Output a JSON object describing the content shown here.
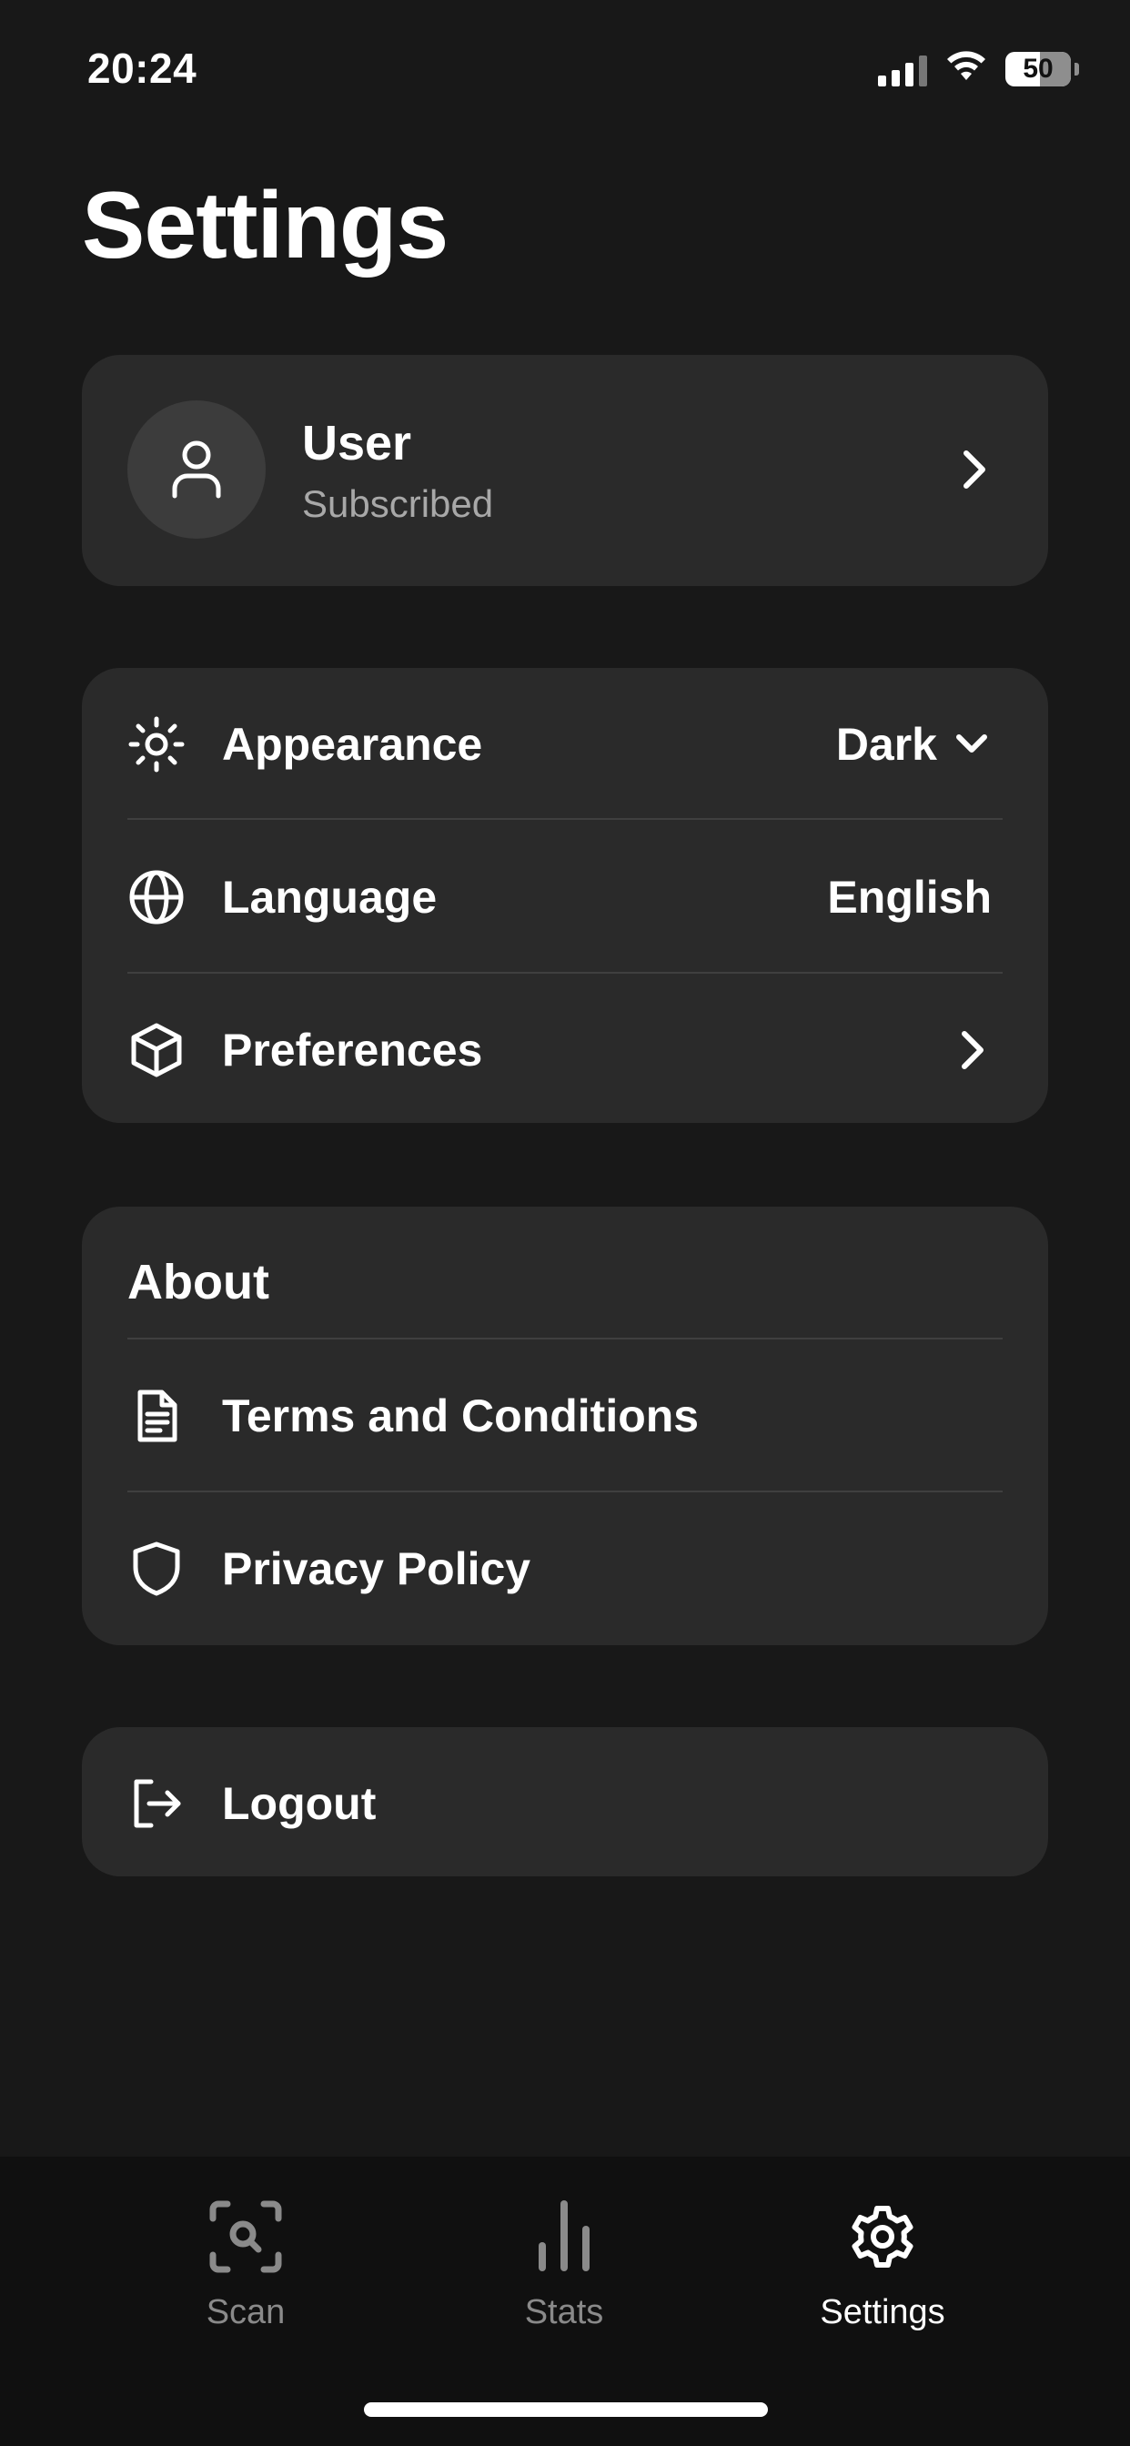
{
  "status_bar": {
    "time": "20:24",
    "battery": "50"
  },
  "page": {
    "title": "Settings"
  },
  "profile": {
    "name": "User",
    "status": "Subscribed"
  },
  "settings": {
    "appearance": {
      "label": "Appearance",
      "value": "Dark",
      "icon": "sun-icon"
    },
    "language": {
      "label": "Language",
      "value": "English",
      "icon": "globe-icon"
    },
    "preferences": {
      "label": "Preferences",
      "icon": "cube-icon"
    }
  },
  "about": {
    "heading": "About",
    "terms": {
      "label": "Terms and Conditions",
      "icon": "document-icon"
    },
    "privacy": {
      "label": "Privacy Policy",
      "icon": "shield-icon"
    }
  },
  "logout": {
    "label": "Logout",
    "icon": "logout-icon"
  },
  "tabs": [
    {
      "label": "Scan",
      "icon": "scan-icon",
      "active": false
    },
    {
      "label": "Stats",
      "icon": "stats-icon",
      "active": false
    },
    {
      "label": "Settings",
      "icon": "gear-icon",
      "active": true
    }
  ],
  "colors": {
    "background": "#181818",
    "card": "#2a2a2a",
    "inactive_tab": "#8a8a8a",
    "subtle_text": "#a8a8a8"
  }
}
